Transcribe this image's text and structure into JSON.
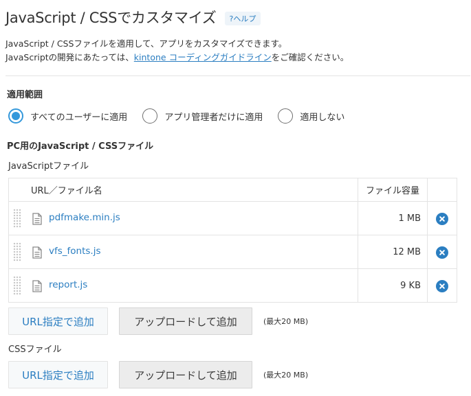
{
  "header": {
    "title": "JavaScript / CSSでカスタマイズ",
    "help_label": "?ヘルプ"
  },
  "description": {
    "line1": "JavaScript / CSSファイルを適用して、アプリをカスタマイズできます。",
    "line2_prefix": "JavaScriptの開発にあたっては、",
    "line2_link": "kintone コーディングガイドライン",
    "line2_suffix": "をご確認ください。"
  },
  "scope": {
    "label": "適用範囲",
    "options": [
      {
        "label": "すべてのユーザーに適用",
        "selected": true
      },
      {
        "label": "アプリ管理者だけに適用",
        "selected": false
      },
      {
        "label": "適用しない",
        "selected": false
      }
    ]
  },
  "pc": {
    "title": "PC用のJavaScript / CSSファイル",
    "js": {
      "label": "JavaScriptファイル",
      "table": {
        "col_name": "URL／ファイル名",
        "col_size": "ファイル容量",
        "rows": [
          {
            "name": "pdfmake.min.js",
            "size": "1 MB"
          },
          {
            "name": "vfs_fonts.js",
            "size": "12 MB"
          },
          {
            "name": "report.js",
            "size": "9 KB"
          }
        ]
      },
      "url_button": "URL指定で追加",
      "upload_button": "アップロードして追加",
      "max_size": "(最大20 MB)"
    },
    "css": {
      "label": "CSSファイル",
      "url_button": "URL指定で追加",
      "upload_button": "アップロードして追加",
      "max_size": "(最大20 MB)"
    }
  },
  "icons": {
    "file": "document-icon",
    "delete": "close-circle-icon",
    "drag": "drag-handle-icon"
  },
  "colors": {
    "accent": "#2b7ec1",
    "radio_selected": "#3498db"
  }
}
